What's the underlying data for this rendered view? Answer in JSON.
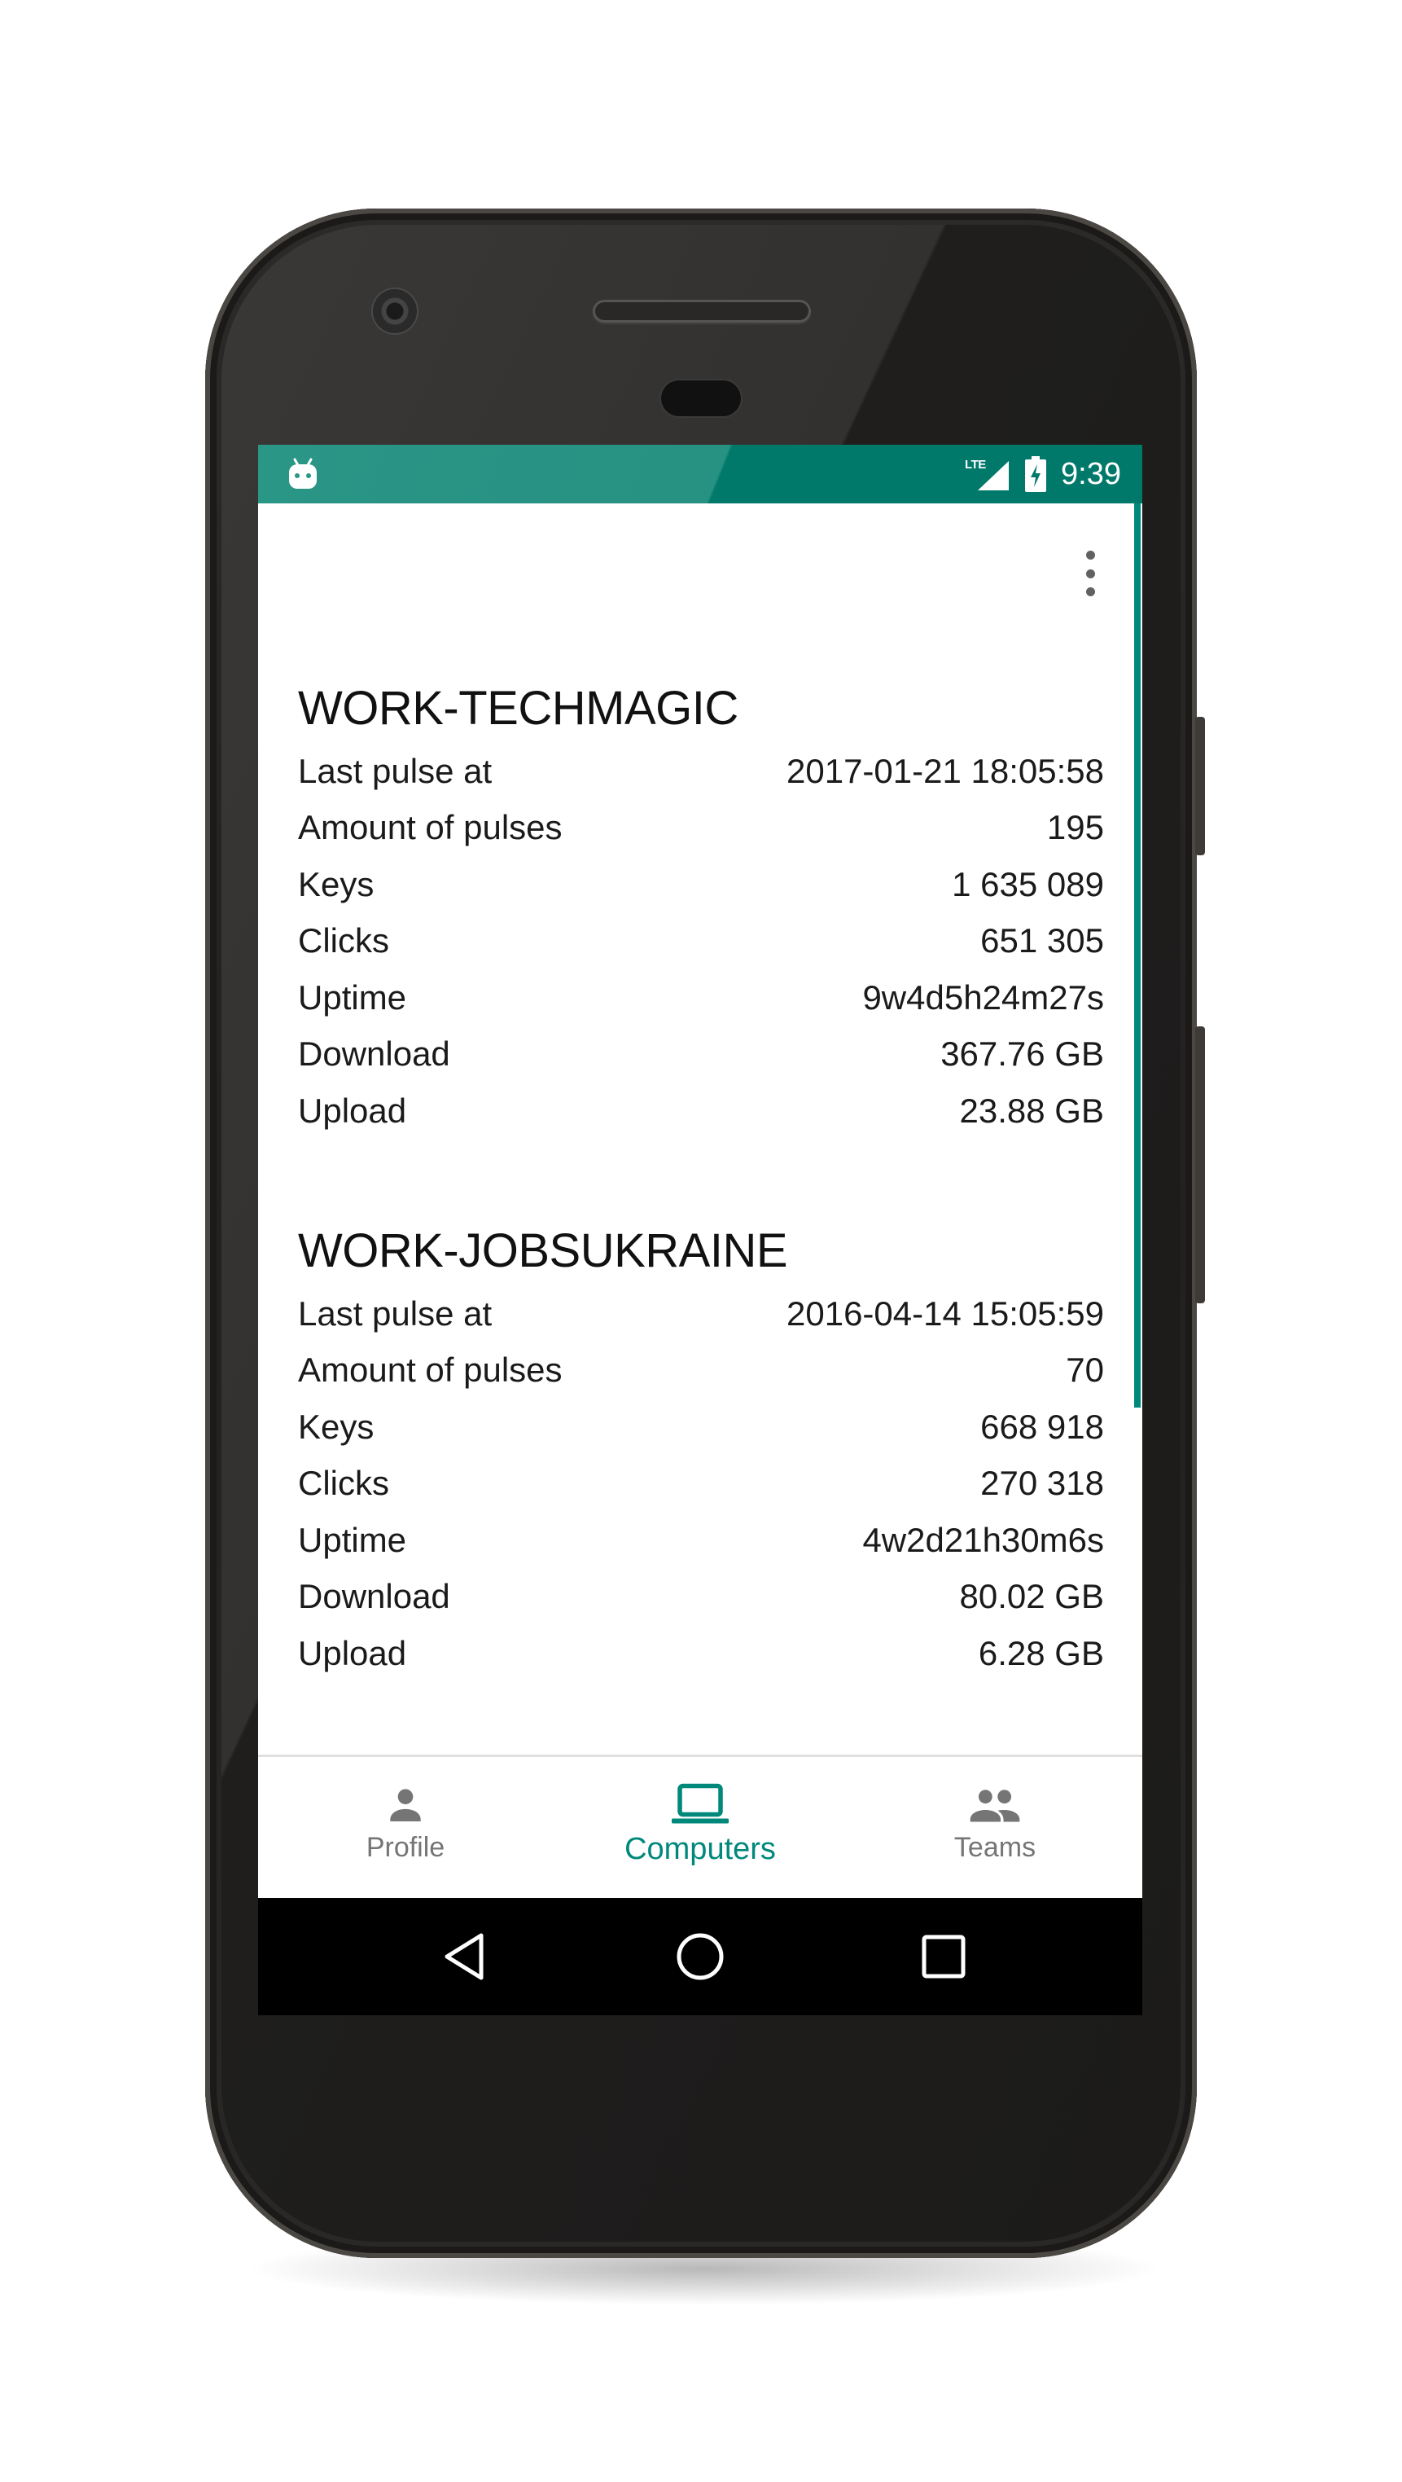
{
  "status_bar": {
    "network": "LTE",
    "time": "9:39",
    "colors": {
      "primary": "#2a9686",
      "primary_dark": "#00796b"
    },
    "icons": [
      "android-debug-icon",
      "lte-signal-icon",
      "battery-charging-icon"
    ]
  },
  "toolbar": {
    "overflow_icon": "more-vert-icon"
  },
  "computers": [
    {
      "name": "WORK-TECHMAGIC",
      "stats": [
        {
          "label": "Last pulse at",
          "value": "2017-01-21 18:05:58"
        },
        {
          "label": "Amount of pulses",
          "value": "195"
        },
        {
          "label": "Keys",
          "value": "1 635 089"
        },
        {
          "label": "Clicks",
          "value": "651 305"
        },
        {
          "label": "Uptime",
          "value": "9w4d5h24m27s"
        },
        {
          "label": "Download",
          "value": "367.76 GB"
        },
        {
          "label": "Upload",
          "value": "23.88 GB"
        }
      ]
    },
    {
      "name": "WORK-JOBSUKRAINE",
      "stats": [
        {
          "label": "Last pulse at",
          "value": "2016-04-14 15:05:59"
        },
        {
          "label": "Amount of pulses",
          "value": "70"
        },
        {
          "label": "Keys",
          "value": "668 918"
        },
        {
          "label": "Clicks",
          "value": "270 318"
        },
        {
          "label": "Uptime",
          "value": "4w2d21h30m6s"
        },
        {
          "label": "Download",
          "value": "80.02 GB"
        },
        {
          "label": "Upload",
          "value": "6.28 GB"
        }
      ]
    }
  ],
  "bottom_nav": {
    "active": "Computers",
    "active_color": "#00897b",
    "inactive_color": "#757575",
    "items": [
      {
        "label": "Profile",
        "icon": "person-icon"
      },
      {
        "label": "Computers",
        "icon": "laptop-icon"
      },
      {
        "label": "Teams",
        "icon": "people-icon"
      }
    ]
  },
  "system_nav": {
    "buttons": [
      "back-icon",
      "home-icon",
      "recents-icon"
    ]
  }
}
